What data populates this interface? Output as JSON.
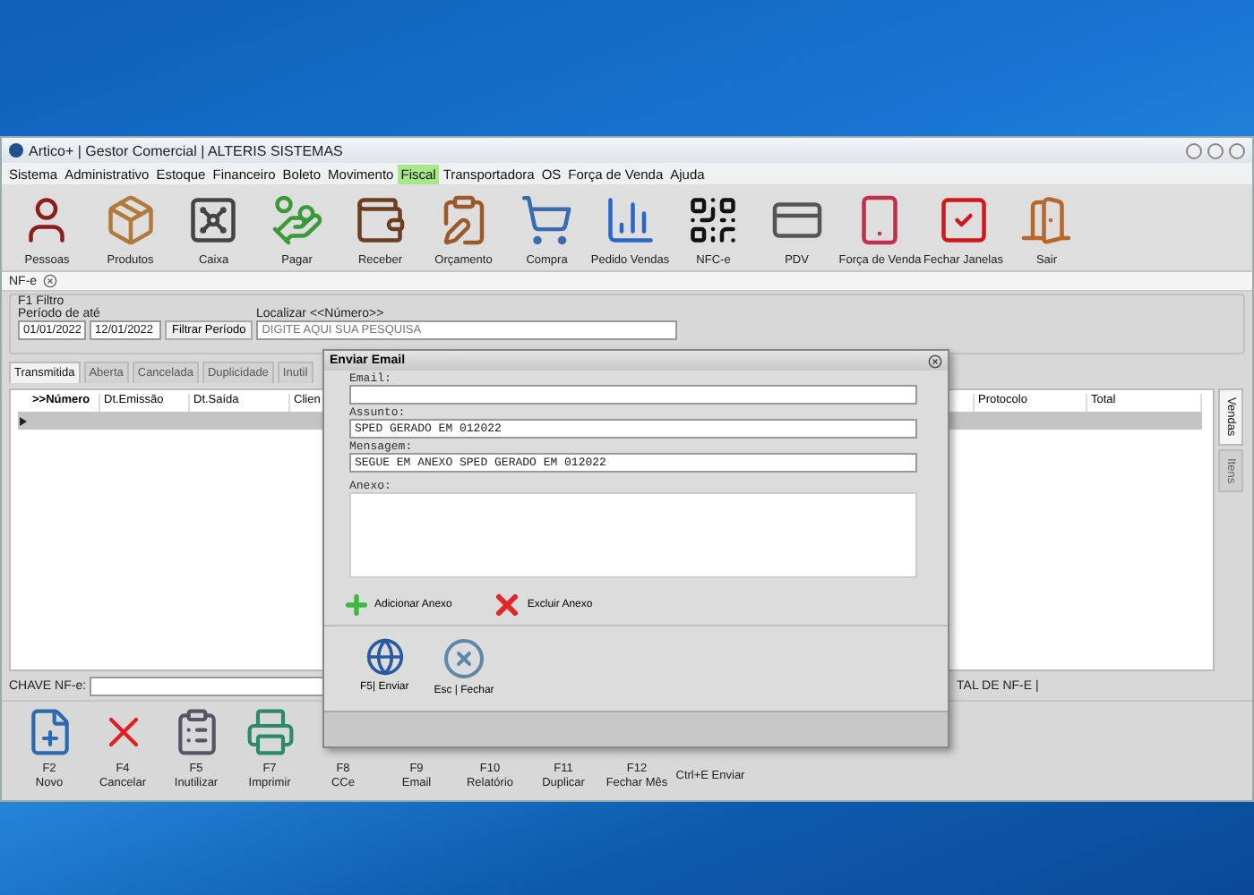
{
  "window": {
    "title": "Artico+ | Gestor Comercial | ALTERIS SISTEMAS"
  },
  "menu": [
    {
      "label": "Sistema",
      "selected": false
    },
    {
      "label": "Administrativo",
      "selected": false
    },
    {
      "label": "Estoque",
      "selected": false
    },
    {
      "label": "Financeiro",
      "selected": false
    },
    {
      "label": "Boleto",
      "selected": false
    },
    {
      "label": "Movimento",
      "selected": false
    },
    {
      "label": "Fiscal",
      "selected": true
    },
    {
      "label": "Transportadora",
      "selected": false
    },
    {
      "label": "OS",
      "selected": false
    },
    {
      "label": "Força de Venda",
      "selected": false
    },
    {
      "label": "Ajuda",
      "selected": false
    }
  ],
  "toolbar": [
    "Pessoas",
    "Produtos",
    "Caixa",
    "Pagar",
    "Receber",
    "Orçamento",
    "Compra",
    "Pedido Vendas",
    "NFC-e",
    "PDV",
    "Força de Venda",
    "Fechar Janelas",
    "Sair"
  ],
  "document_tab": {
    "label": "NF-e"
  },
  "filter": {
    "title": "F1 Filtro",
    "period_label": "Período de  até",
    "date_from": "01/01/2022",
    "date_to": "12/01/2022",
    "filter_button": "Filtrar Período",
    "search_label": "Localizar <<Número>>",
    "search_placeholder": "DIGITE AQUI SUA PESQUISA"
  },
  "tabs": [
    {
      "label": "Transmitida",
      "selected": true
    },
    {
      "label": "Aberta",
      "selected": false
    },
    {
      "label": "Cancelada",
      "selected": false
    },
    {
      "label": "Duplicidade",
      "selected": false
    },
    {
      "label": "Inutil",
      "selected": false
    }
  ],
  "table": {
    "columns": [
      ">>Número",
      "Dt.Emissão",
      "Dt.Saída",
      "Clien",
      "Protocolo",
      "Total"
    ]
  },
  "side_tabs": [
    {
      "label": "Vendas",
      "selected": true
    },
    {
      "label": "Itens",
      "selected": false
    }
  ],
  "chave": {
    "label": "CHAVE NF-e:",
    "total_label": "TAL DE NF-E |"
  },
  "bottom_buttons": [
    {
      "kind": "icon",
      "key": "F2",
      "label": "Novo"
    },
    {
      "kind": "icon",
      "key": "F4",
      "label": "Cancelar"
    },
    {
      "kind": "icon",
      "key": "F5",
      "label": "Inutilizar"
    },
    {
      "kind": "icon",
      "key": "F7",
      "label": "Imprimir"
    },
    {
      "kind": "label",
      "key": "F8",
      "label": "CCe"
    },
    {
      "kind": "label",
      "key": "F9",
      "label": "Email"
    },
    {
      "kind": "label",
      "key": "F10",
      "label": "Relatório"
    },
    {
      "kind": "label",
      "key": "F11",
      "label": "Duplicar"
    },
    {
      "kind": "label",
      "key": "F12",
      "label": "Fechar Mês"
    },
    {
      "kind": "single",
      "label": "Ctrl+E Enviar"
    }
  ],
  "dialog": {
    "title": "Enviar Email",
    "fields": [
      {
        "label": "Email:"
      },
      {
        "label": "Assunto:",
        "value": "SPED GERADO EM 012022"
      },
      {
        "label": "Mensagem:",
        "value": "SEGUE EM ANEXO SPED GERADO EM 012022"
      }
    ],
    "attachment_label": "Anexo:",
    "add_button": "Adicionar Anexo",
    "remove_button": "Excluir Anexo",
    "send_button": "F5| Enviar",
    "close_button": "Esc | Fechar"
  }
}
